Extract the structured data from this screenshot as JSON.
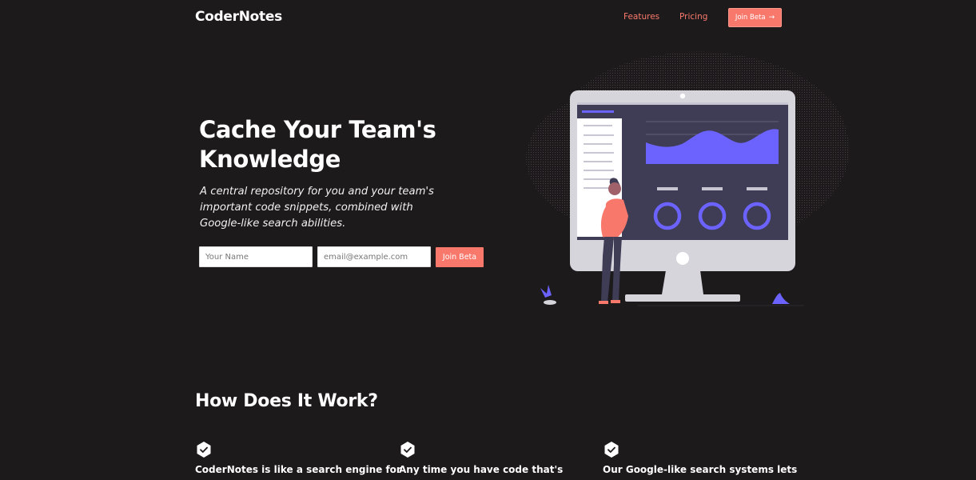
{
  "nav": {
    "logo": "CoderNotes",
    "links": [
      {
        "label": "Features"
      },
      {
        "label": "Pricing"
      }
    ],
    "cta_label": "Join Beta",
    "cta_arrow": "→"
  },
  "hero": {
    "title": "Cache Your Team's Knowledge",
    "subtitle": "A central repository for you and your team's important code snippets, combined with Google-like search abilities.",
    "name_placeholder": "Your Name",
    "email_placeholder": "email@example.com",
    "submit_label": "Join Beta"
  },
  "how": {
    "title": "How Does It Work?",
    "features": [
      {
        "text": "CoderNotes is like a search engine for"
      },
      {
        "text": "Any time you have code that's"
      },
      {
        "text": "Our Google-like search systems lets"
      }
    ]
  },
  "colors": {
    "background": "#1d1a1c",
    "accent": "#f8786c",
    "illustration_purple": "#6c63ff",
    "text": "#ffffff"
  },
  "icons": {
    "feature_icon": "check-hexagon-icon",
    "cta_arrow": "arrow-right-icon"
  }
}
